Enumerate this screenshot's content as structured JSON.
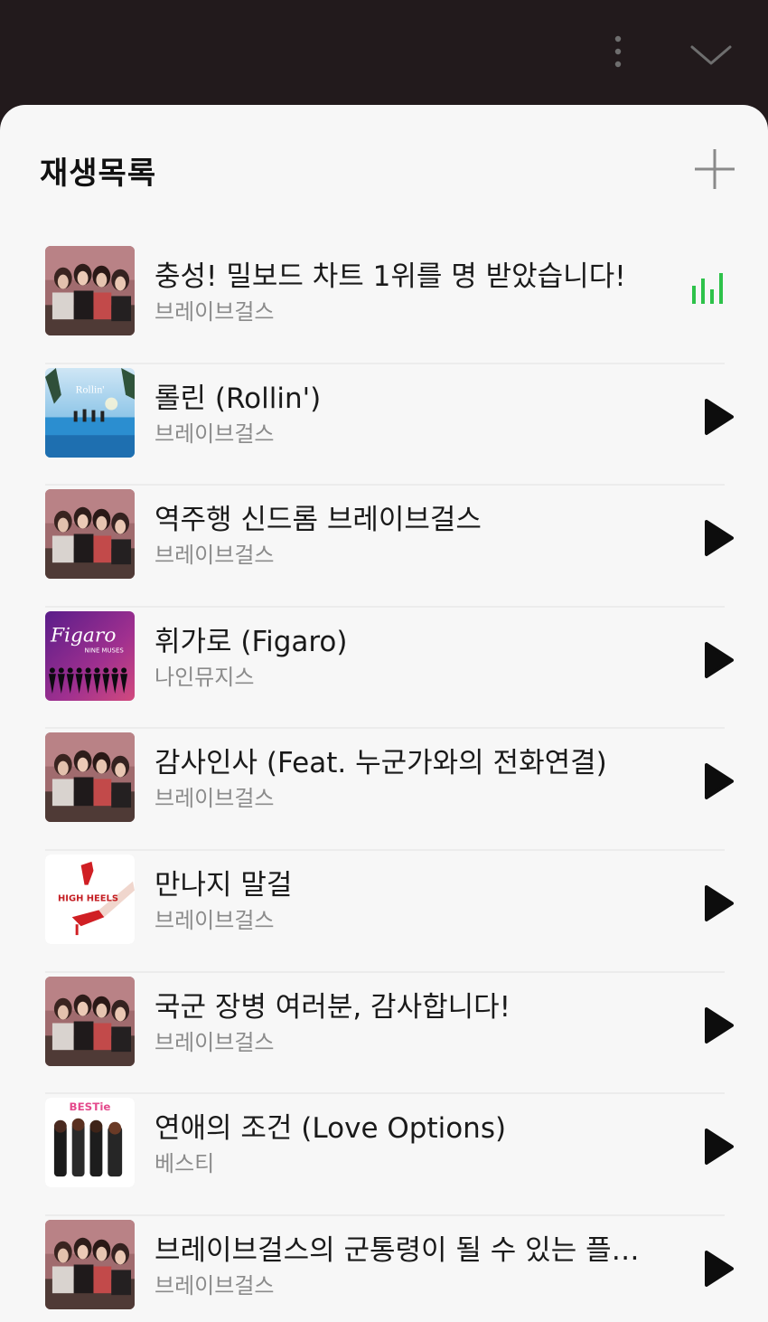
{
  "header": {
    "title": "재생목록"
  },
  "colors": {
    "top_background": "#221a1c",
    "sheet_background": "#f7f7f7",
    "now_playing": "#2ec24a"
  },
  "playlist": [
    {
      "title": "충성! 밀보드 차트 1위를 명 받았습니다!",
      "artist": "브레이브걸스",
      "art": "group-photo",
      "now_playing": true
    },
    {
      "title": "롤린 (Rollin')",
      "artist": "브레이브걸스",
      "art": "rollin-pool",
      "art_text": "Rollin'",
      "now_playing": false
    },
    {
      "title": "역주행 신드롬 브레이브걸스",
      "artist": "브레이브걸스",
      "art": "group-photo",
      "now_playing": false
    },
    {
      "title": "휘가로 (Figaro)",
      "artist": "나인뮤지스",
      "art": "figaro",
      "art_text": "Figaro",
      "art_subtext": "NINE MUSES",
      "now_playing": false
    },
    {
      "title": "감사인사 (Feat. 누군가와의 전화연결)",
      "artist": "브레이브걸스",
      "art": "group-photo",
      "now_playing": false
    },
    {
      "title": "만나지 말걸",
      "artist": "브레이브걸스",
      "art": "high-heels",
      "art_text": "HIGH HEELS",
      "now_playing": false
    },
    {
      "title": "국군 장병 여러분, 감사합니다!",
      "artist": "브레이브걸스",
      "art": "group-photo",
      "now_playing": false
    },
    {
      "title": "연애의 조건 (Love Options)",
      "artist": "베스티",
      "art": "bestie",
      "art_text": "BESTie",
      "now_playing": false
    },
    {
      "title": "브레이브걸스의 군통령이 될 수 있는 플레...",
      "artist": "브레이브걸스",
      "art": "group-photo",
      "now_playing": false
    }
  ]
}
